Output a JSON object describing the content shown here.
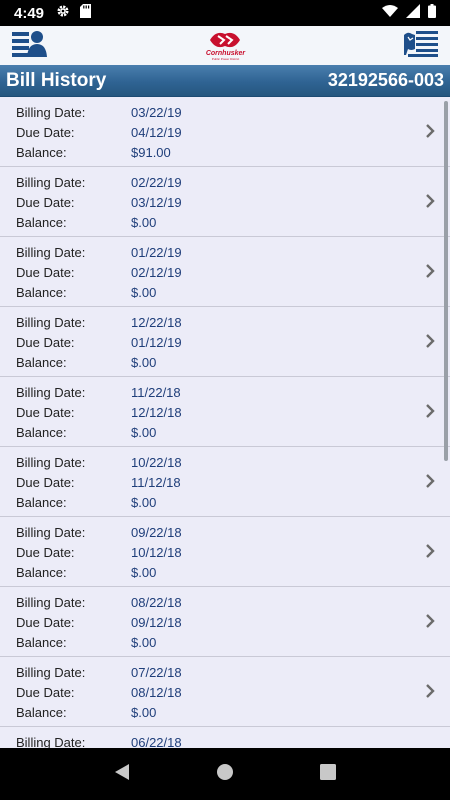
{
  "status_bar": {
    "time": "4:49",
    "icons": [
      "gear-icon",
      "sd-card-icon",
      "wifi-icon",
      "signal-icon",
      "battery-icon"
    ]
  },
  "header": {
    "logo_text": "Cornhusker",
    "logo_sub": "Public Power District",
    "left_icon": "account-menu-icon",
    "right_icon": "flag-icon"
  },
  "title_bar": {
    "title": "Bill History",
    "account_number": "32192566-003"
  },
  "labels": {
    "billing_date": "Billing Date:",
    "due_date": "Due Date:",
    "balance": "Balance:"
  },
  "bills": [
    {
      "billing_date": "03/22/19",
      "due_date": "04/12/19",
      "balance": "$91.00"
    },
    {
      "billing_date": "02/22/19",
      "due_date": "03/12/19",
      "balance": "$.00"
    },
    {
      "billing_date": "01/22/19",
      "due_date": "02/12/19",
      "balance": "$.00"
    },
    {
      "billing_date": "12/22/18",
      "due_date": "01/12/19",
      "balance": "$.00"
    },
    {
      "billing_date": "11/22/18",
      "due_date": "12/12/18",
      "balance": "$.00"
    },
    {
      "billing_date": "10/22/18",
      "due_date": "11/12/18",
      "balance": "$.00"
    },
    {
      "billing_date": "09/22/18",
      "due_date": "10/12/18",
      "balance": "$.00"
    },
    {
      "billing_date": "08/22/18",
      "due_date": "09/12/18",
      "balance": "$.00"
    },
    {
      "billing_date": "07/22/18",
      "due_date": "08/12/18",
      "balance": "$.00"
    },
    {
      "billing_date": "06/22/18",
      "due_date": "",
      "balance": ""
    }
  ],
  "nav_bar": {
    "buttons": [
      "back-icon",
      "home-icon",
      "recents-icon"
    ]
  },
  "colors": {
    "title_bar": "#2f6393",
    "list_bg": "#ececf8",
    "value_text": "#1f3e7a",
    "brand_red": "#c8102e",
    "header_icon": "#1e4f8a"
  }
}
